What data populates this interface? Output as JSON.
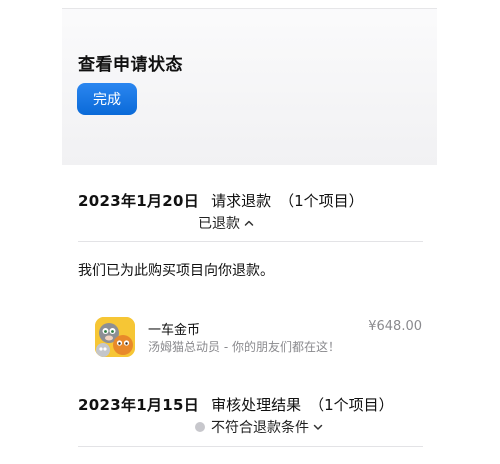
{
  "header": {
    "title": "查看申请状态",
    "done_label": "完成"
  },
  "requests": [
    {
      "date": "2023年1月20日",
      "type": "请求退款",
      "count": "（1个项目）",
      "status": "已退款",
      "status_expanded": true,
      "message": "我们已为此购买项目向你退款。",
      "items": [
        {
          "name": "一车金币",
          "app": "汤姆猫总动员 - 你的朋友们都在这！",
          "price": "¥648.00",
          "icon": "talking-tom-app-icon"
        }
      ]
    },
    {
      "date": "2023年1月15日",
      "type": "审核处理结果",
      "count": "（1个项目）",
      "status": "不符合退款条件",
      "status_expanded": false,
      "status_dot_color": "#c7c7cc"
    }
  ],
  "colors": {
    "accent": "#1a73e8",
    "secondary_text": "#8a8a8e",
    "panel_bg": "#f2f2f4"
  }
}
